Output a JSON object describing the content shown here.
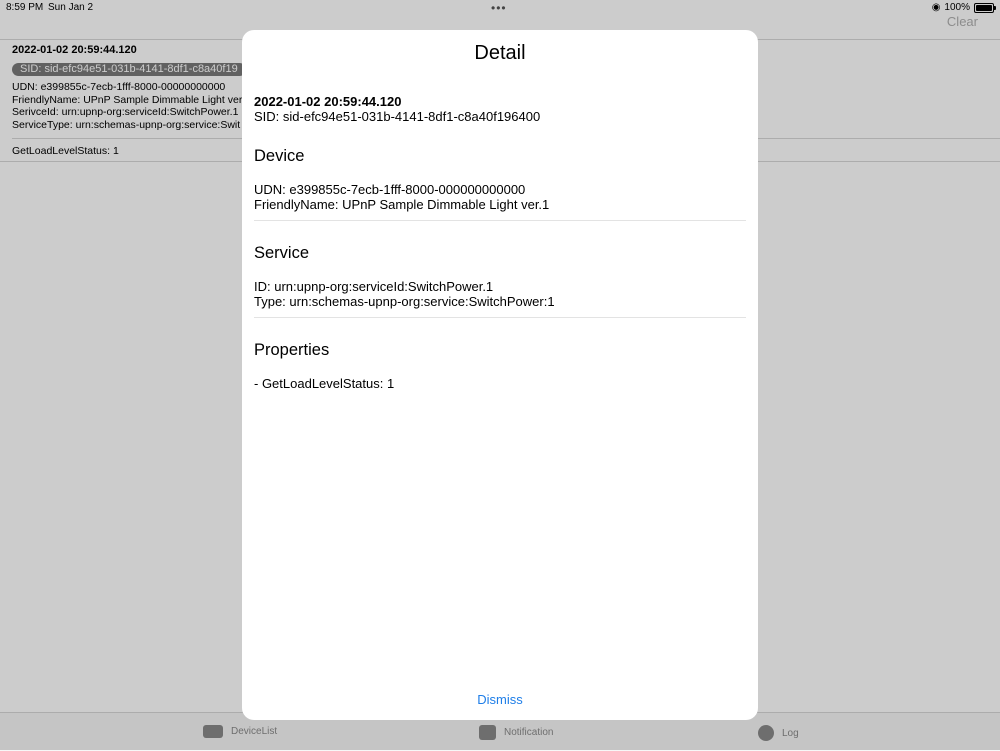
{
  "status_bar": {
    "time": "8:59 PM",
    "date": "Sun Jan 2",
    "battery": "100%"
  },
  "toolbar": {
    "clear_label": "Clear"
  },
  "log_entry": {
    "timestamp": "2022-01-02 20:59:44.120",
    "sid": "SID: sid-efc94e51-031b-4141-8df1-c8a40f19",
    "lines": [
      "UDN: e399855c-7ecb-1fff-8000-00000000000",
      "FriendlyName: UPnP Sample Dimmable Light ver.",
      "SerivceId: urn:upnp-org:serviceId:SwitchPower.1",
      "ServiceType: urn:schemas-upnp-org:service:Swit"
    ],
    "status": "GetLoadLevelStatus: 1"
  },
  "tabs": [
    {
      "label": "DeviceList",
      "icon": "device-list-icon"
    },
    {
      "label": "Notification",
      "icon": "notification-icon"
    },
    {
      "label": "Log",
      "icon": "clock-icon"
    }
  ],
  "detail": {
    "title": "Detail",
    "timestamp": "2022-01-02 20:59:44.120",
    "sid": "SID: sid-efc94e51-031b-4141-8df1-c8a40f196400",
    "device": {
      "title": "Device",
      "udn": "UDN: e399855c-7ecb-1fff-8000-000000000000",
      "friendly_name": "FriendlyName: UPnP Sample Dimmable Light ver.1"
    },
    "service": {
      "title": "Service",
      "id": "ID: urn:upnp-org:serviceId:SwitchPower.1",
      "type": "Type: urn:schemas-upnp-org:service:SwitchPower:1"
    },
    "properties": {
      "title": "Properties",
      "items": [
        "- GetLoadLevelStatus: 1"
      ]
    },
    "dismiss_label": "Dismiss"
  },
  "colors": {
    "accent": "#1e7ee8",
    "pill": "#7a7a7a",
    "dim_overlay": "rgba(0,0,0,0.2)"
  }
}
